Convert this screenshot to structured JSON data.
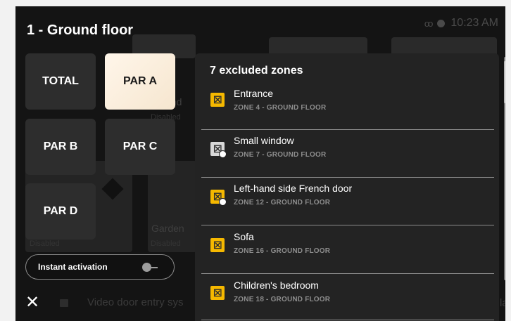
{
  "header": {
    "title": "1 - Ground floor",
    "time": "10:23 AM",
    "voicemail_icon": "voicemail-icon",
    "status_icon": "record-dot-icon"
  },
  "partitions": [
    {
      "label": "TOTAL",
      "active": false
    },
    {
      "label": "PAR A",
      "active": true
    },
    {
      "label": "PAR B",
      "active": false
    },
    {
      "label": "PAR C",
      "active": false
    },
    {
      "label": "PAR D",
      "active": false
    }
  ],
  "instant_activation": {
    "label": "Instant activation",
    "state": "off"
  },
  "background": {
    "tile_labels": [
      "und",
      "Garden"
    ],
    "disabled_labels": [
      "Disabled",
      "Disabled",
      "Disabled"
    ],
    "bottom_text": "Video door entry sys",
    "cut_text": "la"
  },
  "excluded_panel": {
    "title": "7 excluded zones",
    "zones": [
      {
        "name": "Entrance",
        "sub": "ZONE 4 - GROUND FLOOR",
        "icon": "zone-sensor-icon",
        "icon_color": "#f5b800",
        "badge": false
      },
      {
        "name": "Small window",
        "sub": "ZONE 7 - GROUND FLOOR",
        "icon": "zone-sensor-icon",
        "icon_color": "#d8d8d8",
        "badge": true
      },
      {
        "name": "Left-hand side French door",
        "sub": "ZONE 12 - GROUND FLOOR",
        "icon": "zone-sensor-icon",
        "icon_color": "#f5b800",
        "badge": true
      },
      {
        "name": "Sofa",
        "sub": "ZONE 16 - GROUND FLOOR",
        "icon": "zone-sensor-icon",
        "icon_color": "#f5b800",
        "badge": false
      },
      {
        "name": "Children's bedroom",
        "sub": "ZONE 18 - GROUND FLOOR",
        "icon": "zone-sensor-icon",
        "icon_color": "#f5b800",
        "badge": false
      }
    ]
  },
  "footer": {
    "close_icon": "close-icon",
    "home_icon": "home-icon"
  },
  "colors": {
    "accent_active": "#f6e6cf",
    "zone_warning": "#f5b800",
    "panel_bg": "#232323"
  }
}
